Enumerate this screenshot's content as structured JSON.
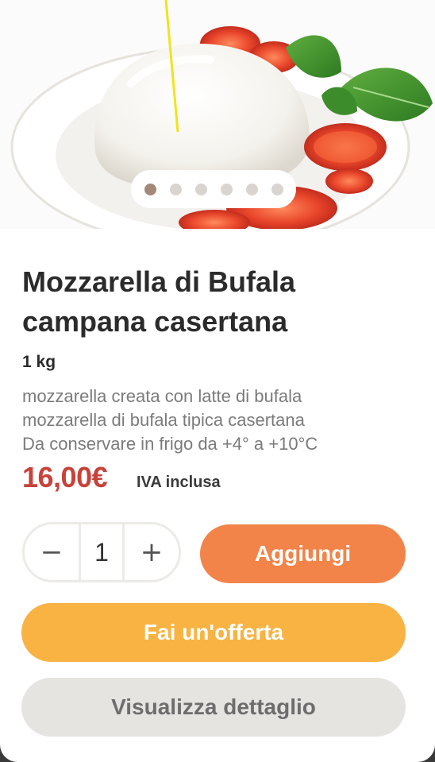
{
  "product": {
    "image_alt": "Mozzarella di Bufala con pomodori e basilico",
    "title": "Mozzarella di Bufala campana casertana",
    "weight": "1 kg",
    "description_lines": [
      "mozzarella creata con latte di bufala",
      "mozzarella di bufala tipica casertana",
      "Da conservare in frigo da +4° a +10°C"
    ],
    "price": "16,00€",
    "vat_note": "IVA inclusa"
  },
  "carousel": {
    "total": 6,
    "active_index": 0
  },
  "quantity": {
    "minus": "−",
    "value": "1",
    "plus": "+"
  },
  "actions": {
    "add": "Aggiungi",
    "offer": "Fai un'offerta",
    "detail": "Visualizza dettaglio"
  },
  "colors": {
    "price": "#c8423a",
    "add_button": "#f28449",
    "offer_button": "#f8b342",
    "detail_button": "#e6e4e1"
  }
}
